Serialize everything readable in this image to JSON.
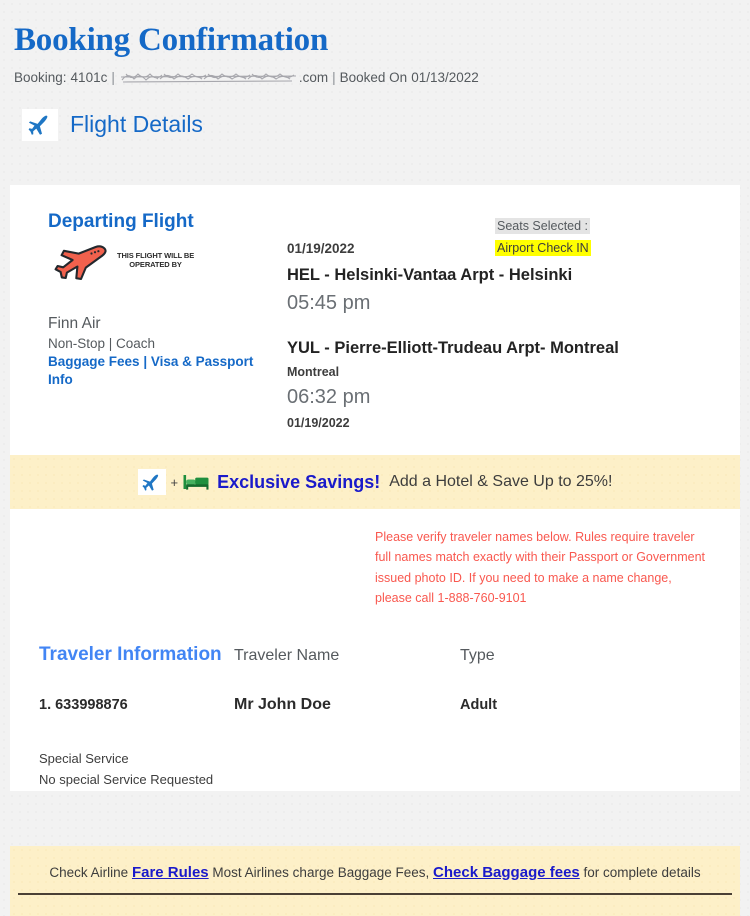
{
  "header": {
    "title": "Booking Confirmation",
    "booking_prefix": "Booking:",
    "booking_id": "4101c",
    "email_redacted": true,
    "email_suffix": ".com",
    "booked_on_label": "Booked On",
    "booked_on_date": "01/13/2022",
    "separator": "|"
  },
  "flight_details_section": {
    "heading": "Flight Details",
    "icon": "airplane-icon"
  },
  "departing_flight": {
    "title": "Departing Flight",
    "operated_by_icon": "red-airplane-icon",
    "operated_by_text_line1": "THIS FLIGHT WILL BE",
    "operated_by_text_line2": "OPERATED BY",
    "airline": "Finn Air",
    "stops_cabin": "Non-Stop  |  Coach",
    "baggage_fees_link": "Baggage Fees",
    "link_separator": "|",
    "visa_passport_link": "Visa & Passport Info",
    "seats_selected_label": "Seats Selected :",
    "seats_selected_value": "Airport Check IN",
    "depart_date": "01/19/2022",
    "depart_airport": "HEL - Helsinki-Vantaa Arpt -  Helsinki",
    "depart_time": "05:45 pm",
    "arrive_airport": "YUL - Pierre-Elliott-Trudeau Arpt- Montreal",
    "arrive_city": "Montreal",
    "arrive_time": "06:32 pm",
    "arrive_date": "01/19/2022"
  },
  "savings_banner": {
    "plane_icon": "airplane-icon",
    "plus": "+",
    "hotel_icon": "bed-icon",
    "headline": "Exclusive Savings!",
    "tail": "Add a Hotel & Save Up to 25%!"
  },
  "verify_notice": {
    "text": "Please verify traveler names below. Rules require traveler full names match exactly with their Passport or Government issued photo ID. If you need to make a name change, please call 1-888-760-9101"
  },
  "traveler_information": {
    "title": "Traveler Information",
    "columns": [
      "Traveler Name",
      "Type"
    ],
    "rows": [
      {
        "id": "1. 633998876",
        "name": "Mr John Doe",
        "type": "Adult"
      }
    ],
    "special_service_label": "Special Service",
    "special_service_value": "No special Service Requested"
  },
  "footer": {
    "prefix": "Check Airline ",
    "fare_rules_link": "Fare Rules",
    "middle": " Most Airlines charge Baggage Fees, ",
    "baggage_fees_link": "Check Baggage fees",
    "suffix": " for complete details"
  },
  "colors": {
    "brand_blue": "#1569c7",
    "link_blue": "#1a1aca",
    "traveler_blue": "#4285f4",
    "alert_red": "#f9584f",
    "banner_cream": "#fdf0c8",
    "highlight_yellow": "#ffff00",
    "highlight_gray": "#e4e4e4",
    "plane_red": "#f1614d"
  }
}
